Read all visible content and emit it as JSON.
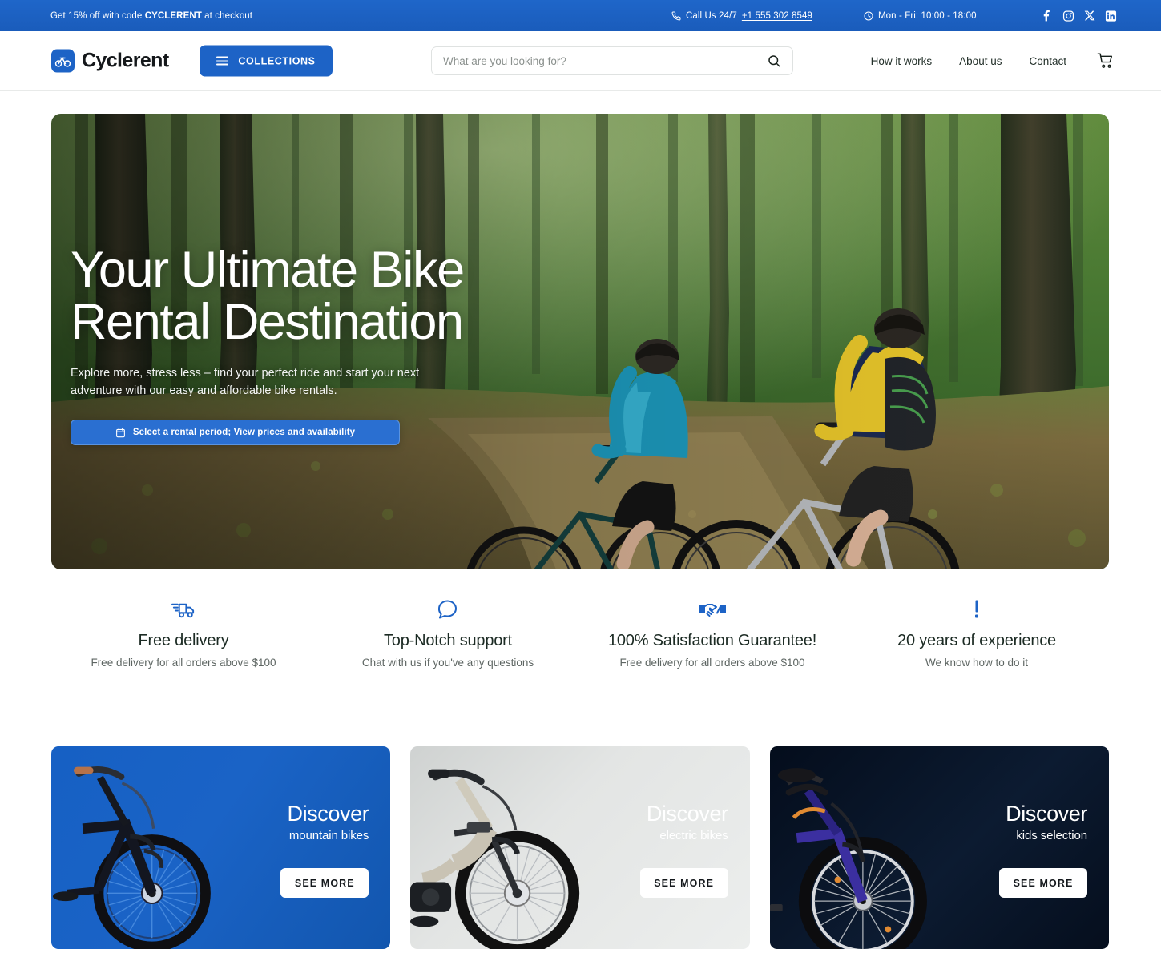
{
  "topbar": {
    "promo_prefix": "Get 15% off with code ",
    "promo_code": "CYCLERENT",
    "promo_suffix": " at checkout",
    "call_label": "Call Us 24/7",
    "phone": "+1 555 302 8549",
    "hours": "Mon - Fri: 10:00 - 18:00",
    "socials": [
      "facebook-icon",
      "instagram-icon",
      "x-twitter-icon",
      "linkedin-icon"
    ],
    "bg_color": "#1d63c6"
  },
  "header": {
    "brand": "Cyclerent",
    "collections_label": "COLLECTIONS",
    "search": {
      "placeholder": "What are you looking for?",
      "value": ""
    },
    "nav": [
      {
        "label": "How it works"
      },
      {
        "label": "About us"
      },
      {
        "label": "Contact"
      }
    ],
    "cart_icon": "shopping-cart-icon",
    "accent_color": "#1d63c6"
  },
  "hero": {
    "title_line1": "Your Ultimate Bike",
    "title_line2": "Rental Destination",
    "subtitle": "Explore more, stress less – find your perfect ride and start your next adventure with our easy and affordable bike rentals.",
    "cta_label": "Select a rental period; View prices and availability",
    "cta_icon": "calendar-icon",
    "image_description": "Two cyclists riding mountain bikes on a forest trail"
  },
  "features": [
    {
      "icon": "delivery-truck-icon",
      "title": "Free delivery",
      "desc": "Free delivery for all orders above $100"
    },
    {
      "icon": "chat-bubble-icon",
      "title": "Top-Notch support",
      "desc": "Chat with us if you've any questions"
    },
    {
      "icon": "handshake-icon",
      "title": "100% Satisfaction Guarantee!",
      "desc": "Free delivery for all orders above $100"
    },
    {
      "icon": "exclamation-icon",
      "title": "20 years of experience",
      "desc": "We know how to do it"
    }
  ],
  "cards": [
    {
      "title": "Discover",
      "subtitle": "mountain bikes",
      "button": "SEE MORE",
      "bg_color": "#1a63c6"
    },
    {
      "title": "Discover",
      "subtitle": "electric bikes",
      "button": "SEE MORE",
      "bg_color": "#e3e5e4"
    },
    {
      "title": "Discover",
      "subtitle": "kids selection",
      "button": "SEE MORE",
      "bg_color": "#0a1628"
    }
  ]
}
